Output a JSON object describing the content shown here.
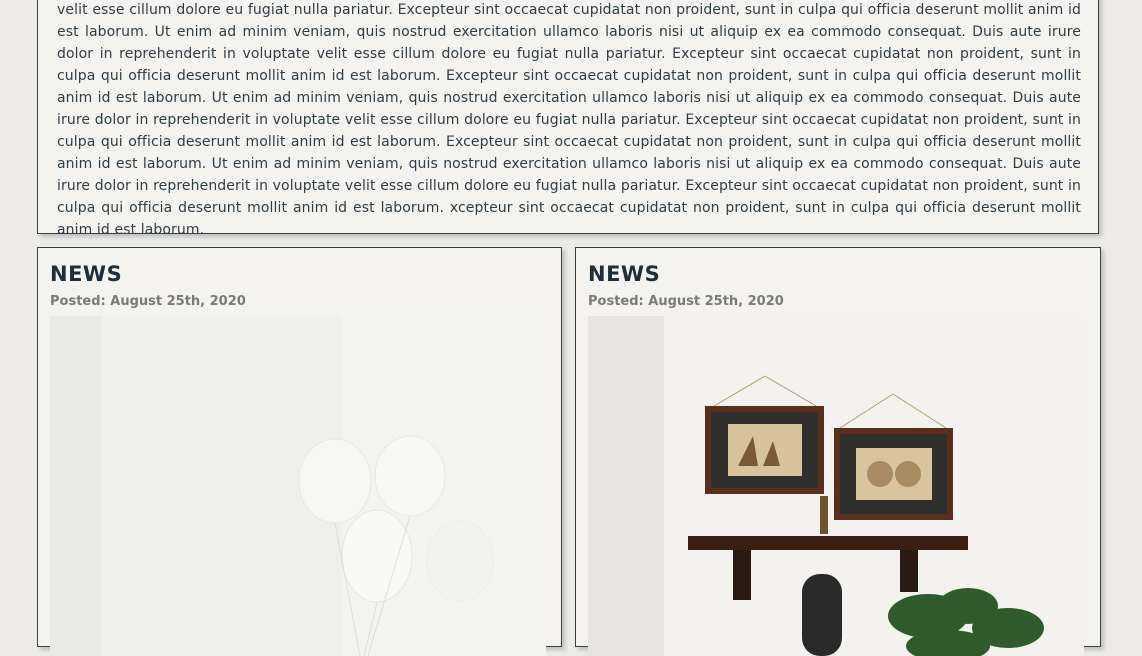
{
  "intro": {
    "text": "velit esse cillum dolore eu fugiat nulla pariatur. Excepteur sint occaecat cupidatat non proident, sunt in culpa qui officia deserunt mollit anim id est laborum. Ut enim ad minim veniam, quis nostrud exercitation ullamco laboris nisi ut aliquip ex ea commodo consequat. Duis aute irure dolor in reprehenderit in voluptate velit esse cillum dolore eu fugiat nulla pariatur. Excepteur sint occaecat cupidatat non proident, sunt in culpa qui officia deserunt mollit anim id est laborum. Excepteur sint occaecat cupidatat non proident, sunt in culpa qui officia deserunt mollit anim id est laborum. Ut enim ad minim veniam, quis nostrud exercitation ullamco laboris nisi ut aliquip ex ea commodo consequat. Duis aute irure dolor in reprehenderit in voluptate velit esse cillum dolore eu fugiat nulla pariatur. Excepteur sint occaecat cupidatat non proident, sunt in culpa qui officia deserunt mollit anim id est laborum. Excepteur sint occaecat cupidatat non proident, sunt in culpa qui officia deserunt mollit anim id est laborum. Ut enim ad minim veniam, quis nostrud exercitation ullamco laboris nisi ut aliquip ex ea commodo consequat. Duis aute irure dolor in reprehenderit in voluptate velit esse cillum dolore eu fugiat nulla pariatur. Excepteur sint occaecat cupidatat non proident, sunt in culpa qui officia deserunt mollit anim id est laborum. xcepteur sint occaecat cupidatat non proident, sunt in culpa qui officia deserunt mollit anim id est laborum."
  },
  "news": [
    {
      "title": "NEWS",
      "date": "Posted: August 25th, 2020",
      "image": "white-balloons-photo"
    },
    {
      "title": "NEWS",
      "date": "Posted: August 25th, 2020",
      "image": "shelf-with-framed-maps-photo"
    }
  ]
}
